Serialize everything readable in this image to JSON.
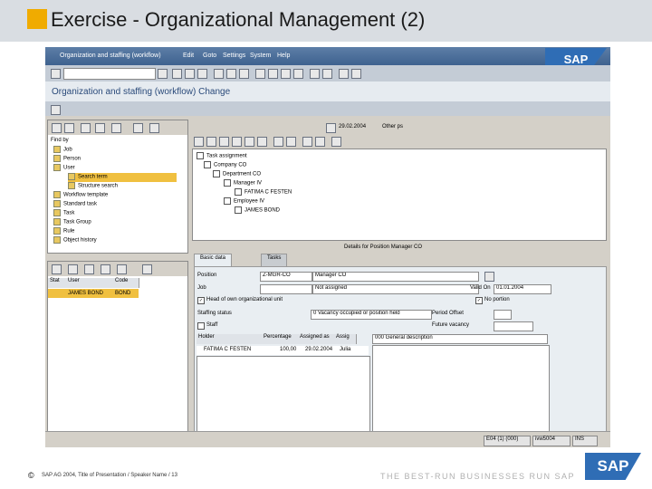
{
  "slide": {
    "title": "Exercise - Organizational Management (2)",
    "footer": "SAP AG 2004, Title of Presentation / Speaker Name / 13",
    "copyright_symbol": "©",
    "slogan": "THE BEST-RUN BUSINESSES RUN SAP",
    "logo_text": "SAP"
  },
  "window": {
    "menu": [
      "Organization and staffing (workflow)",
      "Edit",
      "Goto",
      "Settings",
      "System",
      "Help"
    ],
    "logo_text": "SAP",
    "screen_title": "Organization and staffing (workflow) Change"
  },
  "left_tree": {
    "find_by_label": "Find by",
    "items": [
      {
        "label": "Job",
        "selected": false
      },
      {
        "label": "Person",
        "selected": false
      },
      {
        "label": "User",
        "selected": false
      },
      {
        "label": "Search term",
        "selected": true
      },
      {
        "label": "Structure search",
        "selected": false
      },
      {
        "label": "Workflow template",
        "selected": false
      },
      {
        "label": "Standard task",
        "selected": false
      },
      {
        "label": "Task",
        "selected": false
      },
      {
        "label": "Task Group",
        "selected": false
      },
      {
        "label": "Rule",
        "selected": false
      },
      {
        "label": "Object history",
        "selected": false
      }
    ]
  },
  "result_list": {
    "columns": [
      "Stat",
      "User",
      "Code"
    ],
    "rows": [
      {
        "stat": "",
        "user": "JAMES BOND",
        "code": "BOND"
      }
    ]
  },
  "right_tree": {
    "date": "29.02.2004",
    "period": "Other ps",
    "rows": [
      {
        "label": "Task assignment"
      },
      {
        "label": "Company CO"
      },
      {
        "label": "Department CO"
      },
      {
        "label": "Manager IV"
      },
      {
        "label": "FATIMA C FESTEN"
      },
      {
        "label": "Employee IV"
      },
      {
        "label": "JAMES BOND"
      }
    ]
  },
  "details": {
    "title": "Details for Position Manager CO",
    "tabs": [
      "Basic data",
      "Tasks"
    ],
    "position_label": "Position",
    "position_code": "Z-MGR-CO",
    "position_name": "Manager CO",
    "job_label": "Job",
    "job_code": "",
    "job_name": "Not assigned",
    "valid_on_label": "Valid On",
    "valid_on_value": "01.01.2004",
    "head_of_org_label": "Head of own organizational unit",
    "no_portion_label": "No portion",
    "staffing_status_label": "Staffing status",
    "staffing_status_value": "0 Vacancy occupied or position held",
    "period_label": "Period Offset",
    "staff_label": "Staff",
    "future_label": "Future vacancy",
    "holder_columns": [
      "Holder",
      "Percentage",
      "Assigned as",
      "Assig"
    ],
    "holder_rows": [
      {
        "holder": "FATIMA C FESTEN",
        "percentage": "100,00",
        "assigned": "29.02.2004",
        "assig": "Julia"
      }
    ],
    "description_value": "000 General description"
  },
  "status": {
    "system": "E04 (1) (000)",
    "client": "ivw5004",
    "mode": "INS"
  }
}
